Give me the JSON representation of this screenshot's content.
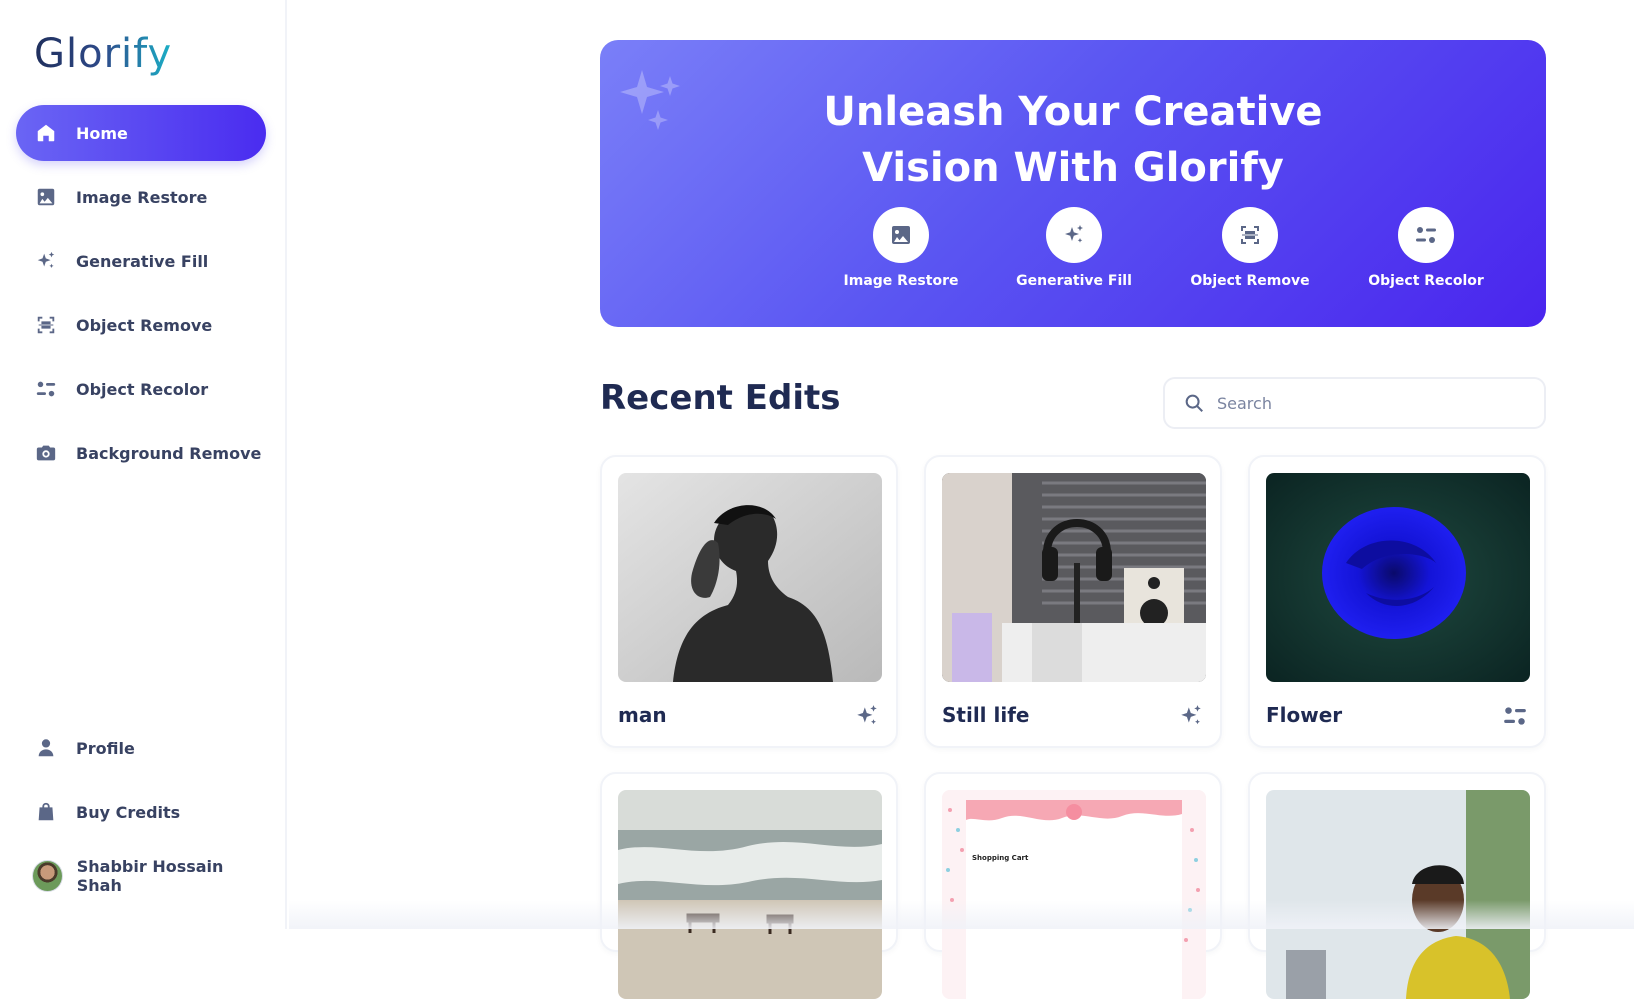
{
  "app": {
    "logo_text": "Glorify"
  },
  "sidebar": {
    "items": [
      {
        "label": "Home",
        "icon": "home-icon",
        "active": true
      },
      {
        "label": "Image Restore",
        "icon": "image-icon"
      },
      {
        "label": "Generative Fill",
        "icon": "sparkles-icon"
      },
      {
        "label": "Object Remove",
        "icon": "scan-icon"
      },
      {
        "label": "Object Recolor",
        "icon": "filter-icon"
      },
      {
        "label": "Background Remove",
        "icon": "camera-icon"
      }
    ],
    "bottom": [
      {
        "label": "Profile",
        "icon": "user-icon"
      },
      {
        "label": "Buy Credits",
        "icon": "bag-icon"
      }
    ],
    "user": {
      "name": "Shabbir Hossain Shah"
    }
  },
  "hero": {
    "title_line1": "Unleash Your Creative",
    "title_line2": "Vision With Glorify",
    "tools": [
      {
        "label": "Image Restore",
        "icon": "image-icon"
      },
      {
        "label": "Generative Fill",
        "icon": "sparkles-icon"
      },
      {
        "label": "Object Remove",
        "icon": "scan-icon"
      },
      {
        "label": "Object Recolor",
        "icon": "filter-icon"
      }
    ],
    "colors": {
      "start": "#7a7ff8",
      "end": "#4a25ee"
    }
  },
  "recent": {
    "title": "Recent Edits",
    "search_placeholder": "Search",
    "cards": [
      {
        "title": "man",
        "icon": "sparkles-icon"
      },
      {
        "title": "Still life",
        "icon": "sparkles-icon"
      },
      {
        "title": "Flower",
        "icon": "filter-icon"
      },
      {
        "title": "",
        "icon": ""
      },
      {
        "title": "",
        "icon": "",
        "thumbnail_text": "Shopping Cart"
      },
      {
        "title": "",
        "icon": ""
      }
    ]
  }
}
